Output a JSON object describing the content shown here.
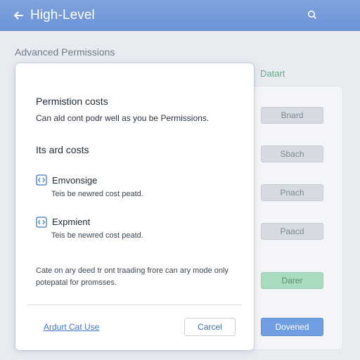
{
  "header": {
    "title": "High-Level",
    "back_icon": "arrow-left-icon",
    "search_icon": "search-icon",
    "background": "#7a9fdc"
  },
  "main": {
    "section_title": "Advanced Permissions"
  },
  "right_panel": {
    "label": "Datart",
    "buttons": [
      "Bnard",
      "Sbach",
      "Pnach",
      "Paacd"
    ],
    "status_button": "Darer",
    "primary_button": "Dovened"
  },
  "dialog": {
    "title": "Permistion costs",
    "description": "Can ald cont podr well as you be Permissions.",
    "subtitle": "Its ard costs",
    "items": [
      {
        "name": "Emvonsige",
        "description": "Teis be newred cost peatd.",
        "icon": "code-square-icon"
      },
      {
        "name": "Expmient",
        "description": "Teis be newred cost peatd.",
        "icon": "code-square-icon"
      }
    ],
    "note": "Cate on ary deed tr ont traading frore can ary mode only potepatal for promsses.",
    "link": "Ardurt Cat Use",
    "cancel": "Carcel"
  },
  "colors": {
    "accent": "#6f9fe0",
    "link": "#3f78c8",
    "success": "#a9dcbf"
  }
}
